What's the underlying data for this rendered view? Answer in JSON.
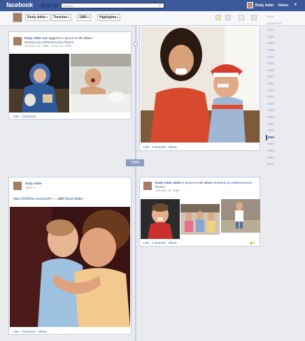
{
  "topbar": {
    "logo": "facebook",
    "search_placeholder": "Search",
    "user_name": "Rudy Adler",
    "home_label": "Home"
  },
  "subbar": {
    "crumbs": [
      "Rudy Adler",
      "Timeline",
      "1985",
      "Highlights"
    ]
  },
  "scrubber": {
    "years": [
      "Now",
      "December",
      "2011",
      "2010",
      "2009",
      "2008",
      "2007",
      "2006",
      "2005",
      "2004",
      "2003",
      "2002",
      "2001",
      "2000",
      "1990",
      "1980",
      "1987",
      "1986",
      "1985",
      "1984",
      "1983",
      "1982",
      "Born"
    ],
    "current": "1985"
  },
  "year_marker": "1984",
  "post1": {
    "name": "Rudy Adler",
    "text_mid": " was tagged in ",
    "photos_link": "2 photos",
    "text_end": " in the album",
    "album": "Shoebox by 1000memories Photos.",
    "date": "January 15, 1985 - June 15, 1985",
    "actions": [
      "Like",
      "Comment"
    ]
  },
  "post2": {
    "actions": [
      "Like",
      "Comment",
      "Share"
    ]
  },
  "post3": {
    "name": "Rudy Adler",
    "date": "1984",
    "link": "http://1000me.ms/yvxvFx",
    "with_text": " — with ",
    "with_name": "Aaron Adler.",
    "actions": [
      "Like",
      "Comment",
      "Share"
    ]
  },
  "post4": {
    "name": "Rudy Adler",
    "text_mid": " added ",
    "photos_link": "3 photos",
    "text_end": " to the album ",
    "album": "Shoebox by 1000memories Photos.",
    "date": "January 15, 1984",
    "actions": [
      "Like",
      "Comment",
      "Share"
    ],
    "likes": "7"
  }
}
